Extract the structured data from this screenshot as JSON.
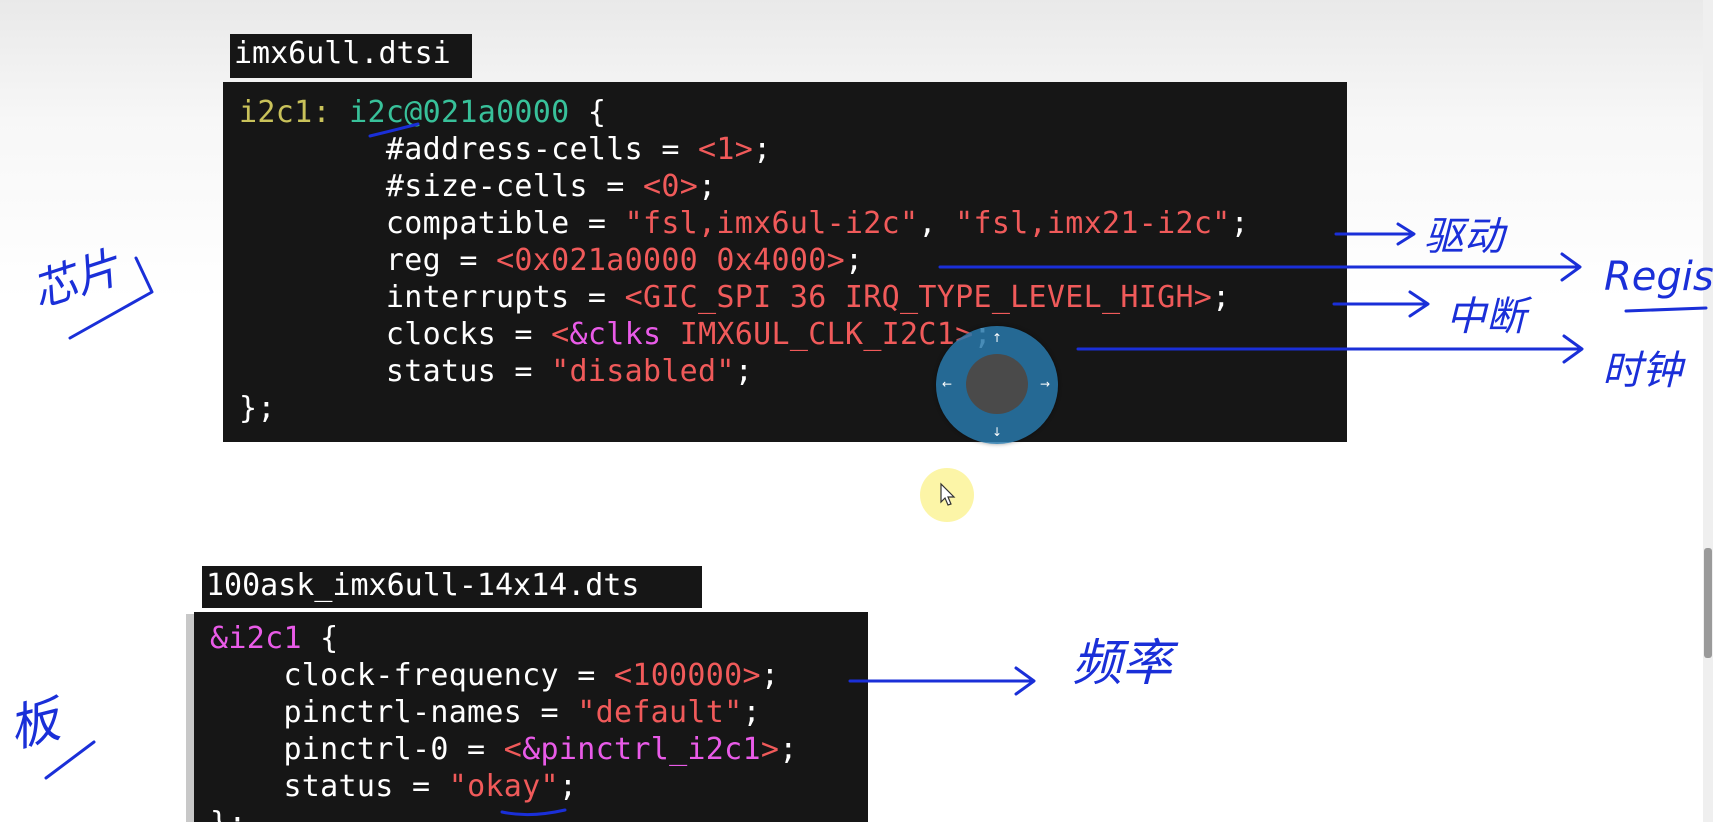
{
  "top_file": {
    "label": "imx6ull.dtsi",
    "lines": [
      [
        {
          "c": "c-label",
          "t": "i2c1: "
        },
        {
          "c": "c-node",
          "t": "i2c@021a0000"
        },
        {
          "c": "c-white",
          "t": " {"
        }
      ],
      [
        {
          "c": "c-white",
          "t": "        #address-cells = "
        },
        {
          "c": "c-red",
          "t": "<1>"
        },
        {
          "c": "c-white",
          "t": ";"
        }
      ],
      [
        {
          "c": "c-white",
          "t": "        #size-cells = "
        },
        {
          "c": "c-red",
          "t": "<0>"
        },
        {
          "c": "c-white",
          "t": ";"
        }
      ],
      [
        {
          "c": "c-white",
          "t": "        compatible = "
        },
        {
          "c": "c-red",
          "t": "\"fsl,imx6ul-i2c\""
        },
        {
          "c": "c-white",
          "t": ", "
        },
        {
          "c": "c-red",
          "t": "\"fsl,imx21-i2c\""
        },
        {
          "c": "c-white",
          "t": ";"
        }
      ],
      [
        {
          "c": "c-white",
          "t": "        reg = "
        },
        {
          "c": "c-red",
          "t": "<0x021a0000 0x4000>"
        },
        {
          "c": "c-white",
          "t": ";"
        }
      ],
      [
        {
          "c": "c-white",
          "t": "        interrupts = "
        },
        {
          "c": "c-red",
          "t": "<GIC_SPI 36 IRQ_TYPE_LEVEL_HIGH>"
        },
        {
          "c": "c-white",
          "t": ";"
        }
      ],
      [
        {
          "c": "c-white",
          "t": "        clocks = "
        },
        {
          "c": "c-red",
          "t": "<"
        },
        {
          "c": "c-magenta",
          "t": "&clks"
        },
        {
          "c": "c-red",
          "t": " IMX6UL_CLK_I2C1>"
        },
        {
          "c": "c-white",
          "t": ";"
        }
      ],
      [
        {
          "c": "c-white",
          "t": "        status = "
        },
        {
          "c": "c-red",
          "t": "\"disabled\""
        },
        {
          "c": "c-white",
          "t": ";"
        }
      ],
      [
        {
          "c": "c-white",
          "t": "};"
        }
      ]
    ]
  },
  "bottom_file": {
    "label": "100ask_imx6ull-14x14.dts",
    "lines": [
      [
        {
          "c": "c-magenta",
          "t": "&i2c1"
        },
        {
          "c": "c-white",
          "t": " {"
        }
      ],
      [
        {
          "c": "c-white",
          "t": "    clock-frequency = "
        },
        {
          "c": "c-red",
          "t": "<100000>"
        },
        {
          "c": "c-white",
          "t": ";"
        }
      ],
      [
        {
          "c": "c-white",
          "t": "    pinctrl-names = "
        },
        {
          "c": "c-red",
          "t": "\"default\""
        },
        {
          "c": "c-white",
          "t": ";"
        }
      ],
      [
        {
          "c": "c-white",
          "t": "    pinctrl-0 = "
        },
        {
          "c": "c-red",
          "t": "<"
        },
        {
          "c": "c-magenta",
          "t": "&pinctrl_i2c1"
        },
        {
          "c": "c-red",
          "t": ">"
        },
        {
          "c": "c-white",
          "t": ";"
        }
      ],
      [
        {
          "c": "c-white",
          "t": "    status = "
        },
        {
          "c": "c-red",
          "t": "\"okay\""
        },
        {
          "c": "c-white",
          "t": ";"
        }
      ],
      [
        {
          "c": "c-white",
          "t": "};"
        }
      ]
    ]
  },
  "annotations": {
    "label_chip_left": "芯片",
    "label_board_left": "板",
    "arrow_driver": "驱动",
    "arrow_register": "Regist",
    "arrow_interrupt": "中断",
    "arrow_clock": "时钟",
    "arrow_frequency": "频率"
  },
  "colors": {
    "ink": "#1a2fd8",
    "code_bg": "#161616",
    "string_red": "#f05a5a",
    "label_yellow": "#c9c25a",
    "node_green": "#38c19a",
    "ref_magenta": "#e95be8"
  },
  "widgets": {
    "nav_widget_icon": "pan-navigation-icon",
    "cursor_icon": "mouse-cursor-icon"
  }
}
